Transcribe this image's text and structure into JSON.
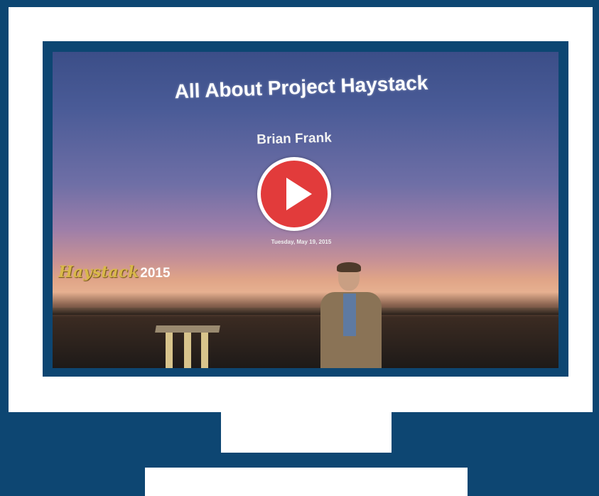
{
  "video": {
    "slide_title": "All About Project Haystack",
    "presenter_name": "Brian Frank",
    "date": "Tuesday, May 19, 2015",
    "event_logo_text": "Haystack",
    "event_year": "2015"
  },
  "controls": {
    "play_icon": "play-icon"
  },
  "colors": {
    "background": "#0d4672",
    "play_button": "#e23b3b",
    "bezel": "#ffffff"
  }
}
